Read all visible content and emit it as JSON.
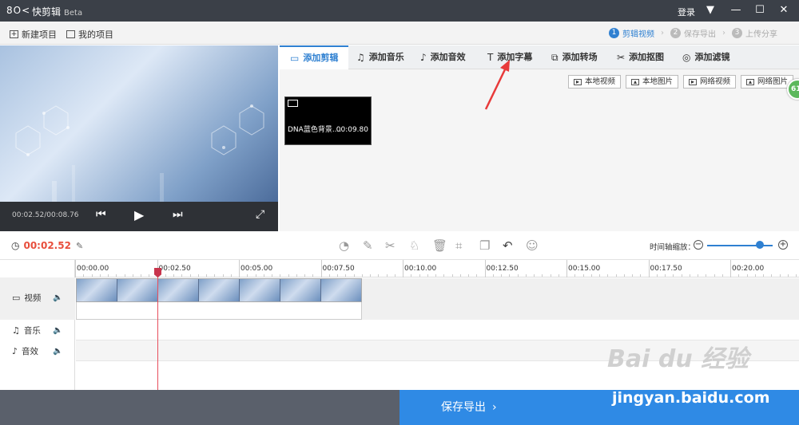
{
  "app": {
    "logo": "8O<",
    "title": "快剪辑",
    "beta": "Beta",
    "login": "登录"
  },
  "window_controls": {
    "menu_icon": "menu-icon",
    "minimize_icon": "minimize-icon",
    "maximize_icon": "maximize-icon",
    "close_icon": "close-icon"
  },
  "toolbar": {
    "new_project": "新建项目",
    "my_projects": "我的项目"
  },
  "steps": [
    {
      "num": "1",
      "label": "剪辑视频",
      "active": true
    },
    {
      "num": "2",
      "label": "保存导出",
      "active": false
    },
    {
      "num": "3",
      "label": "上传分享",
      "active": false
    }
  ],
  "player": {
    "time": "00:02.52/00:08.76"
  },
  "tabs": [
    {
      "label": "添加剪辑",
      "icon": "video-icon",
      "active": true
    },
    {
      "label": "添加音乐",
      "icon": "music-icon"
    },
    {
      "label": "添加音效",
      "icon": "sound-effect-icon"
    },
    {
      "label": "添加字幕",
      "icon": "text-icon"
    },
    {
      "label": "添加转场",
      "icon": "transition-icon"
    },
    {
      "label": "添加抠图",
      "icon": "cutout-icon"
    },
    {
      "label": "添加滤镜",
      "icon": "filter-icon"
    }
  ],
  "source_buttons": [
    "本地视频",
    "本地图片",
    "网络视频",
    "网络图片"
  ],
  "badge": "61",
  "media": {
    "name": "DNA蓝色背景....",
    "duration": "00:09.80"
  },
  "timeline": {
    "current_time": "00:02.52",
    "zoom_label": "时间轴缩放：",
    "ruler": [
      "00:00.00",
      "00:02.50",
      "00:05.00",
      "00:07.50",
      "00:10.00",
      "00:12.50",
      "00:15.00",
      "00:17.50",
      "00:20.00"
    ],
    "tracks": {
      "video": "视频",
      "music": "音乐",
      "sfx": "音效"
    }
  },
  "save_export": "保存导出",
  "watermark": {
    "brand": "Bai du 经验",
    "url": "jingyan.baidu.com"
  },
  "colors": {
    "accent": "#2f80d1",
    "time_red": "#e84e3c",
    "save_blue": "#2f8ae5",
    "titlebar": "#3b4048"
  }
}
